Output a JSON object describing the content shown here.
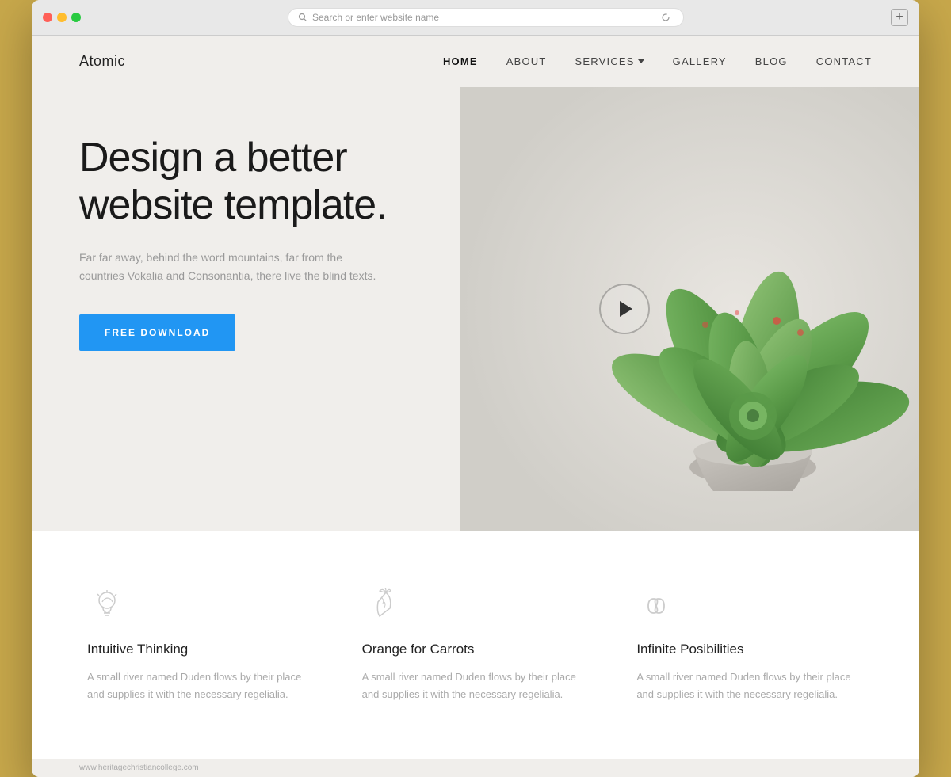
{
  "browser": {
    "address_placeholder": "Search or enter website name",
    "new_tab_label": "+"
  },
  "nav": {
    "logo": "Atomic",
    "links": [
      {
        "label": "HOME",
        "active": true,
        "has_dropdown": false
      },
      {
        "label": "ABOUT",
        "active": false,
        "has_dropdown": false
      },
      {
        "label": "SERVICES",
        "active": false,
        "has_dropdown": true
      },
      {
        "label": "GALLERY",
        "active": false,
        "has_dropdown": false
      },
      {
        "label": "BLOG",
        "active": false,
        "has_dropdown": false
      },
      {
        "label": "CONTACT",
        "active": false,
        "has_dropdown": false
      }
    ]
  },
  "hero": {
    "title": "Design a better\nwebsite template.",
    "subtitle": "Far far away, behind the word mountains, far from the countries Vokalia and Consonantia, there live the blind texts.",
    "cta_label": "FREE DOWNLOAD"
  },
  "features": [
    {
      "icon": "lightbulb",
      "title": "Intuitive Thinking",
      "description": "A small river named Duden flows by their place and supplies it with the necessary regelialia."
    },
    {
      "icon": "carrot",
      "title": "Orange for Carrots",
      "description": "A small river named Duden flows by their place and supplies it with the necessary regelialia."
    },
    {
      "icon": "infinity",
      "title": "Infinite Posibilities",
      "description": "A small river named Duden flows by their place and supplies it with the necessary regelialia."
    }
  ],
  "footer": {
    "url": "www.heritagechristiancollege.com"
  },
  "colors": {
    "primary": "#2196f3",
    "text_dark": "#1a1a1a",
    "text_muted": "#999",
    "bg_hero": "#f0eeeb",
    "bg_white": "#ffffff",
    "icon_color": "#bbb",
    "outer_border": "#c8a84b"
  }
}
